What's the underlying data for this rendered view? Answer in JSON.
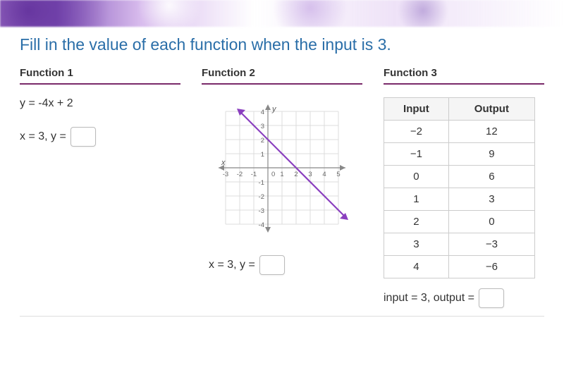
{
  "question": "Fill in the value of each function when the input is 3.",
  "func1": {
    "title": "Function 1",
    "equation": "y = -4x + 2",
    "prompt_prefix": "x = 3, y ="
  },
  "func2": {
    "title": "Function 2",
    "prompt_prefix": "x = 3, y =",
    "axis_x_label": "x",
    "axis_y_label": "y"
  },
  "func3": {
    "title": "Function 3",
    "table": {
      "head_input": "Input",
      "head_output": "Output",
      "rows": [
        {
          "in": "−2",
          "out": "12"
        },
        {
          "in": "−1",
          "out": "9"
        },
        {
          "in": "0",
          "out": "6"
        },
        {
          "in": "1",
          "out": "3"
        },
        {
          "in": "2",
          "out": "0"
        },
        {
          "in": "3",
          "out": "−3"
        },
        {
          "in": "4",
          "out": "−6"
        }
      ]
    },
    "prompt_prefix": "input = 3, output ="
  },
  "chart_data": {
    "type": "line",
    "title": "",
    "xlabel": "x",
    "ylabel": "y",
    "xlim": [
      -3,
      5
    ],
    "ylim": [
      -4,
      4
    ],
    "x_ticks": [
      -3,
      -2,
      -1,
      0,
      1,
      2,
      3,
      4,
      5
    ],
    "y_ticks": [
      -4,
      -3,
      -2,
      -1,
      0,
      1,
      2,
      3,
      4
    ],
    "grid": true,
    "series": [
      {
        "name": "line",
        "color": "#8a3fbf",
        "equation_intercept_form": "y = -x + 2",
        "points": [
          {
            "x": -2,
            "y": 4
          },
          {
            "x": 0,
            "y": 2
          },
          {
            "x": 2,
            "y": 0
          },
          {
            "x": 5,
            "y": -3
          }
        ]
      }
    ]
  }
}
